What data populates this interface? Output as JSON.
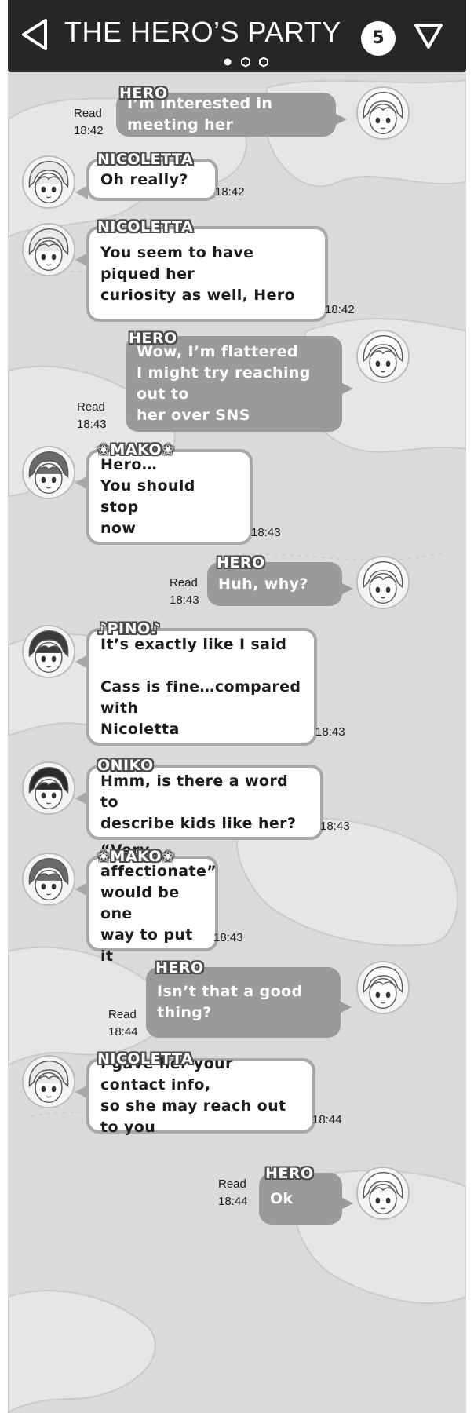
{
  "header": {
    "title": "THE HERO’S PARTY",
    "member_count": "5",
    "back_icon": "back-triangle-icon",
    "menu_icon": "down-triangle-icon"
  },
  "colors": {
    "header_bg": "#262626",
    "chat_bg": "#d8dadc",
    "outgoing_bubble": "#999a9c",
    "incoming_bubble": "#ffffff",
    "incoming_border": "#a8a8a8"
  },
  "messages": [
    {
      "sender": "HERO",
      "outgoing": true,
      "lines": [
        "I’m interested in meeting her"
      ],
      "read": "Read",
      "time": "18:42"
    },
    {
      "sender": "NICOLETTA",
      "outgoing": false,
      "lines": [
        "Oh really?"
      ],
      "time": "18:42"
    },
    {
      "sender": "NICOLETTA",
      "outgoing": false,
      "lines": [
        "You seem to have piqued her",
        "curiosity as well, Hero"
      ],
      "time": "18:42"
    },
    {
      "sender": "HERO",
      "outgoing": true,
      "lines": [
        "Wow, I’m flattered",
        "I might try reaching out to",
        "her over SNS"
      ],
      "read": "Read",
      "time": "18:43"
    },
    {
      "sender": "✬MAKO✬",
      "outgoing": false,
      "lines": [
        "Hero…",
        "You should stop",
        "now"
      ],
      "time": "18:43"
    },
    {
      "sender": "HERO",
      "outgoing": true,
      "lines": [
        "Huh, why?"
      ],
      "read": "Read",
      "time": "18:43"
    },
    {
      "sender": "♪PINO♪",
      "outgoing": false,
      "lines": [
        "It’s exactly like I said",
        "",
        "Cass is fine…compared with",
        "Nicoletta"
      ],
      "time": "18:43"
    },
    {
      "sender": "ONIKO",
      "outgoing": false,
      "lines": [
        "Hmm, is there a word to",
        "describe kids like her?"
      ],
      "time": "18:43"
    },
    {
      "sender": "✬MAKO✬",
      "outgoing": false,
      "lines": [
        "“Very",
        "affectionate”",
        "would be one",
        "way to put it"
      ],
      "time": "18:43"
    },
    {
      "sender": "HERO",
      "outgoing": true,
      "lines": [
        "Isn’t that a good thing?"
      ],
      "read": "Read",
      "time": "18:44"
    },
    {
      "sender": "NICOLETTA",
      "outgoing": false,
      "lines": [
        "I gave her your contact info,",
        "so she may reach out to you"
      ],
      "time": "18:44"
    },
    {
      "sender": "HERO",
      "outgoing": true,
      "lines": [
        "Ok"
      ],
      "read": "Read",
      "time": "18:44"
    }
  ]
}
